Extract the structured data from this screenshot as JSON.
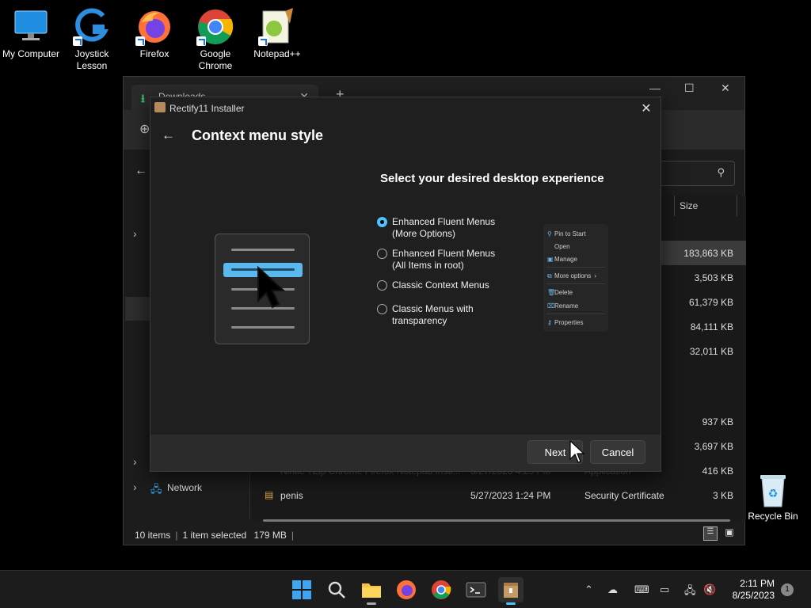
{
  "desktop": {
    "icons": [
      {
        "label": "My Computer",
        "icon": "monitor-icon"
      },
      {
        "label": "Joystick Lesson",
        "icon": "joystick-app-icon"
      },
      {
        "label": "Firefox",
        "icon": "firefox-icon"
      },
      {
        "label": "Google Chrome",
        "icon": "chrome-icon"
      },
      {
        "label": "Notepad++",
        "icon": "notepadpp-icon"
      }
    ],
    "recycle_bin": "Recycle Bin"
  },
  "explorer": {
    "tab_title": "Downloads",
    "column_size": "Size",
    "sizes": [
      "183,863 KB",
      "3,503 KB",
      "61,379 KB",
      "84,111 KB",
      "32,011 KB",
      "937 KB",
      "3,697 KB",
      "416 KB"
    ],
    "obscured_row": {
      "name": "Ninite 7Zip Chrome Firefox Notepad Insti...",
      "date": "5/27/2023 4:29 PM",
      "type": "Application"
    },
    "last_row": {
      "name": "penis",
      "date": "5/27/2023 1:24 PM",
      "type": "Security Certificate",
      "size": "3 KB"
    },
    "nav_network": "Network",
    "status": {
      "items": "10 items",
      "selected": "1 item selected",
      "size": "179 MB"
    }
  },
  "installer": {
    "title": "Rectify11 Installer",
    "heading": "Context menu style",
    "subheading": "Select your desired desktop experience",
    "options": [
      {
        "line1": "Enhanced Fluent Menus",
        "line2": "(More Options)",
        "selected": true
      },
      {
        "line1": "Enhanced Fluent Menus",
        "line2": "(All Items in root)",
        "selected": false
      },
      {
        "line1": "Classic Context Menus",
        "line2": "",
        "selected": false
      },
      {
        "line1": "Classic Menus with",
        "line2": "transparency",
        "selected": false
      }
    ],
    "preview_items": [
      "Pin to Start",
      "Open",
      "Manage",
      "More options",
      "Delete",
      "Rename",
      "Properties"
    ],
    "next_label": "Next",
    "cancel_label": "Cancel"
  },
  "taskbar": {
    "time": "2:11 PM",
    "date": "8/25/2023",
    "notification_count": "1"
  },
  "colors": {
    "accent": "#4cc2ff",
    "taskbar": "#1c1c1c",
    "dialog": "#1f1f1f"
  }
}
